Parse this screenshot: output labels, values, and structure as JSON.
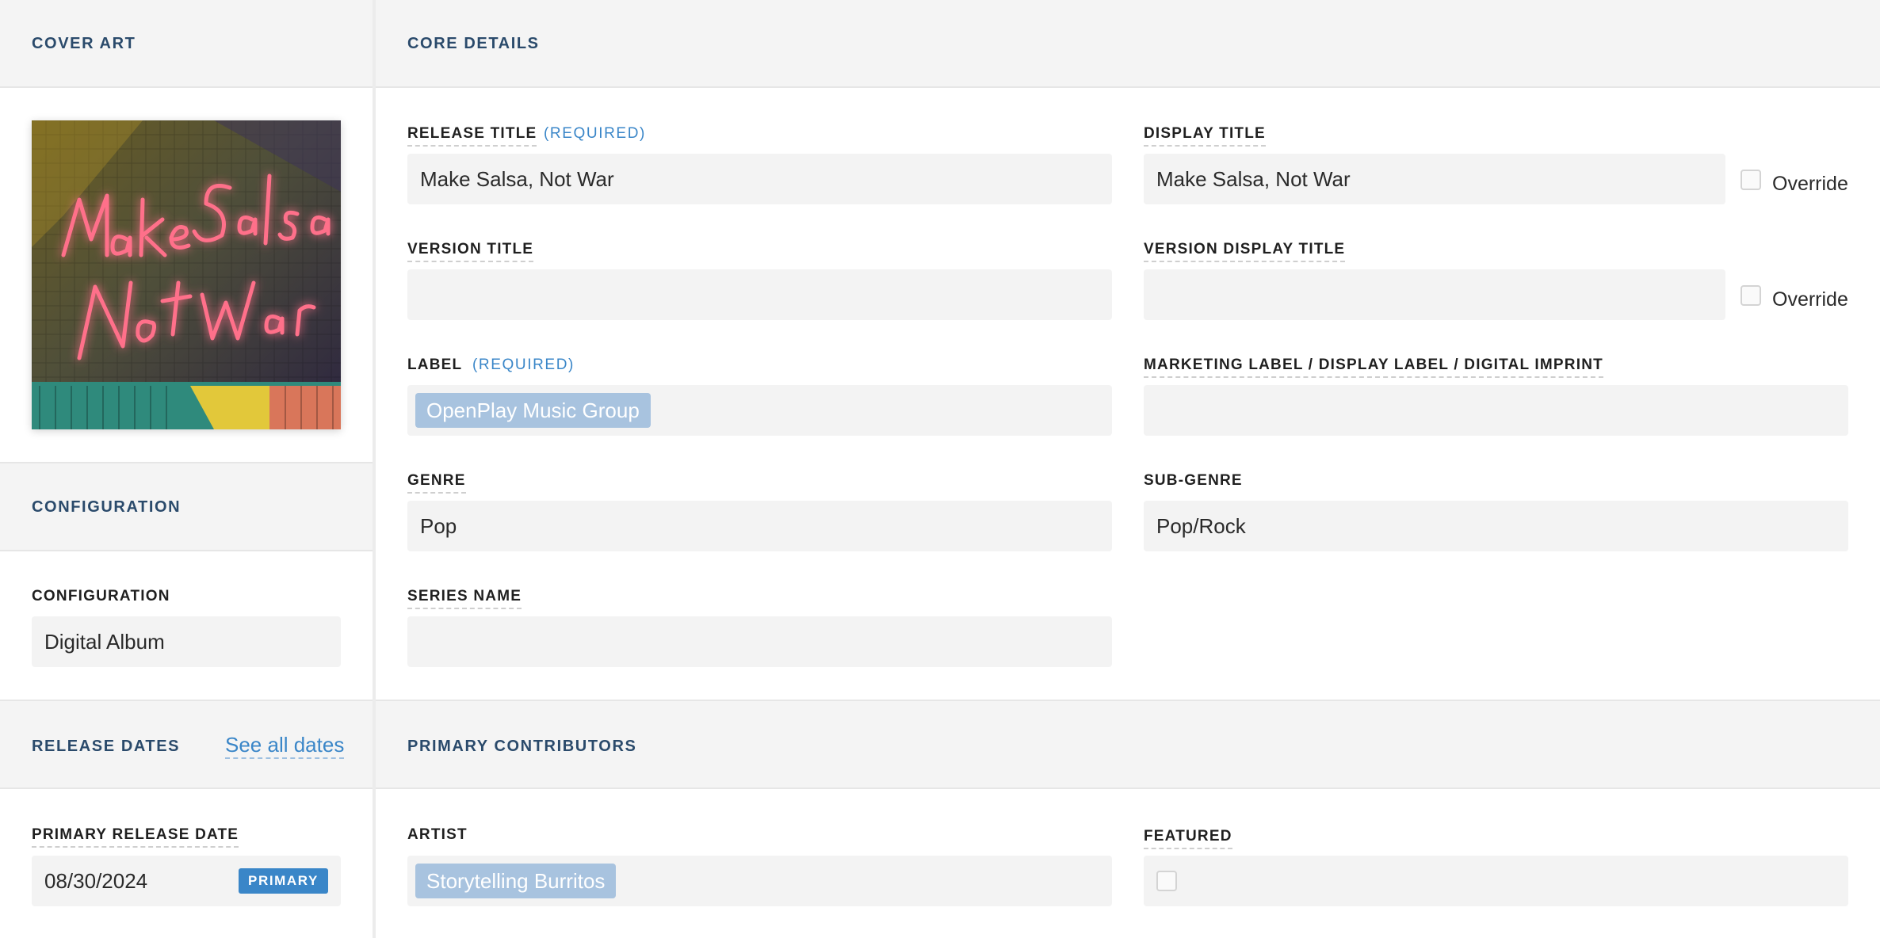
{
  "cover_art": {
    "title": "COVER ART",
    "image_alt": "Make Salsa Not War"
  },
  "core_details": {
    "title": "CORE DETAILS",
    "release_title": {
      "label": "RELEASE TITLE",
      "required": "(REQUIRED)",
      "value": "Make Salsa, Not War"
    },
    "display_title": {
      "label": "DISPLAY TITLE",
      "value": "Make Salsa, Not War",
      "override": "Override"
    },
    "version_title": {
      "label": "VERSION TITLE",
      "value": ""
    },
    "version_display_title": {
      "label": "VERSION DISPLAY TITLE",
      "value": "",
      "override": "Override"
    },
    "label": {
      "label": "LABEL",
      "required": "(REQUIRED)",
      "chip": "OpenPlay Music Group"
    },
    "marketing_label": {
      "label": "MARKETING LABEL / DISPLAY LABEL / DIGITAL IMPRINT",
      "value": ""
    },
    "genre": {
      "label": "GENRE",
      "value": "Pop"
    },
    "sub_genre": {
      "label": "SUB-GENRE",
      "value": "Pop/Rock"
    },
    "series_name": {
      "label": "SERIES NAME",
      "value": ""
    }
  },
  "configuration": {
    "title": "CONFIGURATION",
    "field_label": "CONFIGURATION",
    "value": "Digital Album"
  },
  "release_dates": {
    "title": "RELEASE DATES",
    "see_all": "See all dates",
    "primary_label": "PRIMARY RELEASE DATE",
    "primary_value": "08/30/2024",
    "badge": "PRIMARY"
  },
  "primary_contributors": {
    "title": "PRIMARY CONTRIBUTORS",
    "artist_label": "ARTIST",
    "artist_chip": "Storytelling Burritos",
    "featured_label": "FEATURED"
  },
  "colors": {
    "accent": "#3a86c8",
    "heading": "#2a4a6b",
    "chip": "#a8c3df",
    "field_bg": "#f3f3f3"
  }
}
